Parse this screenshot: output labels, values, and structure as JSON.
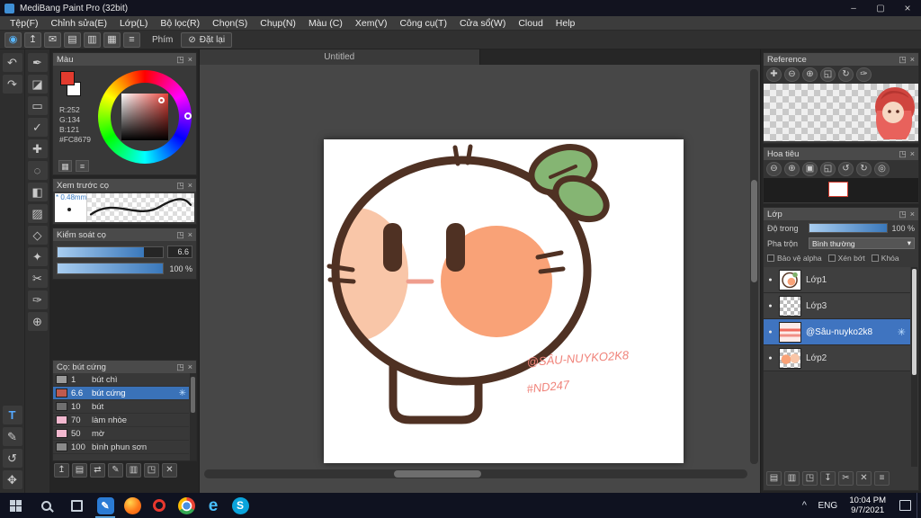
{
  "window": {
    "title": "MediBang Paint Pro (32bit)",
    "controls": {
      "minimize": "–",
      "maximize": "▢",
      "close": "×"
    }
  },
  "menu": {
    "items": [
      "Tệp(F)",
      "Chỉnh sửa(E)",
      "Lớp(L)",
      "Bộ lọc(R)",
      "Chọn(S)",
      "Chụp(N)",
      "Màu (C)",
      "Xem(V)",
      "Công cụ(T)",
      "Cửa sổ(W)",
      "Cloud",
      "Help"
    ]
  },
  "toolbar": {
    "icons": [
      {
        "name": "pen-cursor-icon",
        "glyph": "◉",
        "color": "#58b7ff"
      },
      {
        "name": "upload-icon",
        "glyph": "↥"
      },
      {
        "name": "comment-icon",
        "glyph": "✉"
      },
      {
        "name": "note-icon",
        "glyph": "▤"
      },
      {
        "name": "panel-icon",
        "glyph": "▥"
      },
      {
        "name": "grid-icon",
        "glyph": "▦"
      },
      {
        "name": "list-icon",
        "glyph": "≡"
      }
    ],
    "phim_label": "Phím",
    "reset_icon": "⊘",
    "reset_label": "Đặt lại"
  },
  "panel_icons": {
    "popout": "◳",
    "close": "×"
  },
  "tools": {
    "col1_top": [
      {
        "name": "undo-tool",
        "glyph": "↶"
      },
      {
        "name": "redo-tool",
        "glyph": "↷"
      }
    ],
    "col1_bottom": [
      {
        "name": "text-tool",
        "glyph": "T",
        "accent": true
      },
      {
        "name": "select-pen-tool",
        "glyph": "✎"
      },
      {
        "name": "rotate-canvas-tool",
        "glyph": "↺"
      },
      {
        "name": "hand-tool",
        "glyph": "✥"
      }
    ],
    "col2": [
      {
        "name": "brush-tool",
        "glyph": "✒"
      },
      {
        "name": "eraser-tool",
        "glyph": "◪"
      },
      {
        "name": "rect-tool",
        "glyph": "▭"
      },
      {
        "name": "check-tool",
        "glyph": "✓"
      },
      {
        "name": "move-tool",
        "glyph": "✚"
      },
      {
        "name": "marquee-select-tool",
        "glyph": "◌"
      },
      {
        "name": "bucket-tool",
        "glyph": "◧"
      },
      {
        "name": "gradient-tool",
        "glyph": "▨"
      },
      {
        "name": "polygon-select-tool",
        "glyph": "◇"
      },
      {
        "name": "wand-tool",
        "glyph": "✦"
      },
      {
        "name": "snip-tool",
        "glyph": "✂"
      },
      {
        "name": "eyedropper-tool",
        "glyph": "✑"
      },
      {
        "name": "zoom-tool",
        "glyph": "⊕"
      }
    ]
  },
  "color_panel": {
    "title": "Màu",
    "fg_color": "#e23b2e",
    "r_label": "R:252",
    "g_label": "G:134",
    "b_label": "B:121",
    "hex_label": "#FC8679",
    "footer_icons": [
      {
        "name": "palette-icon",
        "glyph": "▦"
      },
      {
        "name": "color-sliders-icon",
        "glyph": "≡"
      }
    ]
  },
  "brush_preview": {
    "title": "Xem trước cọ",
    "size_label": "* 0.48mm"
  },
  "brush_control": {
    "title": "Kiểm soát cọ",
    "rows": [
      {
        "value": "6.6",
        "fill": 82,
        "boxed": true
      },
      {
        "value": "100 %",
        "fill": 100
      }
    ]
  },
  "brush_list": {
    "title": "Cọ: bút cứng",
    "gear_glyph": "✳",
    "items": [
      {
        "size": "1",
        "name": "bút chì",
        "swatch": "#9a9a9a"
      },
      {
        "size": "6.6",
        "name": "bút cứng",
        "swatch": "#c05a4e",
        "selected": true
      },
      {
        "size": "10",
        "name": "bút",
        "swatch": "#6f6f6f"
      },
      {
        "size": "70",
        "name": "làm nhòe",
        "swatch": "#f2b8cf"
      },
      {
        "size": "50",
        "name": "mờ",
        "swatch": "#f2b8cf"
      },
      {
        "size": "100",
        "name": "bình phun sơn",
        "swatch": "#8a8a8a"
      }
    ],
    "bottom_icons": [
      {
        "name": "brush-menu-icon",
        "glyph": "↥"
      },
      {
        "name": "add-brush-icon",
        "glyph": "▤"
      },
      {
        "name": "brush-transfer-icon",
        "glyph": "⇄"
      },
      {
        "name": "edit-brush-icon",
        "glyph": "✎"
      },
      {
        "name": "brush-folder-icon",
        "glyph": "▥"
      },
      {
        "name": "duplicate-brush-icon",
        "glyph": "◳"
      },
      {
        "name": "delete-brush-icon",
        "glyph": "✕"
      }
    ]
  },
  "canvas": {
    "tab_title": "Untitled",
    "signature_line1": "@SÂU-NUYKO2K8",
    "signature_line2": "#ND247"
  },
  "reference_panel": {
    "title": "Reference",
    "toolbar_icons": [
      {
        "name": "ref-move-icon",
        "glyph": "✚"
      },
      {
        "name": "ref-zoom-out-icon",
        "glyph": "⊖"
      },
      {
        "name": "ref-zoom-in-icon",
        "glyph": "⊕"
      },
      {
        "name": "ref-fit-icon",
        "glyph": "◱"
      },
      {
        "name": "ref-rotate-icon",
        "glyph": "↻"
      },
      {
        "name": "ref-eyedropper-icon",
        "glyph": "✑"
      }
    ]
  },
  "navigator_panel": {
    "title": "Hoa tiêu",
    "toolbar_icons": [
      {
        "name": "nav-zoom-out-icon",
        "glyph": "⊖"
      },
      {
        "name": "nav-zoom-in-icon",
        "glyph": "⊕"
      },
      {
        "name": "nav-zoom-100-icon",
        "glyph": "▣"
      },
      {
        "name": "nav-fit-icon",
        "glyph": "◱"
      },
      {
        "name": "nav-rotate-left-icon",
        "glyph": "↺"
      },
      {
        "name": "nav-rotate-right-icon",
        "glyph": "↻"
      },
      {
        "name": "nav-reset-icon",
        "glyph": "◎"
      }
    ]
  },
  "layers_panel": {
    "title": "Lớp",
    "opacity_label": "Độ trong",
    "opacity_value": "100 %",
    "blend_label": "Pha trộn",
    "blend_value": "Bình thường",
    "blend_caret": "▾",
    "options": [
      "Bảo vệ alpha",
      "Xén bớt",
      "Khóa"
    ],
    "visibility_glyph": "●",
    "badge_glyph": "✳",
    "items": [
      {
        "name": "Lớp1",
        "thumb": "art"
      },
      {
        "name": "Lớp3",
        "thumb": "checker"
      },
      {
        "name": "@Sâu-nuyko2k8",
        "thumb": "sig",
        "selected": true
      },
      {
        "name": "Lớp2",
        "thumb": "checker-orange"
      }
    ],
    "bottom_icons": [
      {
        "name": "add-layer-icon",
        "glyph": "▤"
      },
      {
        "name": "duplicate-layer-icon",
        "glyph": "▥"
      },
      {
        "name": "layer-folder-icon",
        "glyph": "◳"
      },
      {
        "name": "merge-down-icon",
        "glyph": "↧"
      },
      {
        "name": "layer-transfer-icon",
        "glyph": "✂"
      },
      {
        "name": "delete-layer-icon",
        "glyph": "✕"
      },
      {
        "name": "layer-menu-icon",
        "glyph": "≡"
      }
    ]
  },
  "taskbar": {
    "apps": [
      {
        "name": "taskbar-app-medibang",
        "kind": "medibang",
        "glyph": "✎",
        "active": true
      },
      {
        "name": "taskbar-app-firefox",
        "kind": "firefox",
        "glyph": ""
      },
      {
        "name": "taskbar-app-opera",
        "kind": "opera",
        "glyph": ""
      },
      {
        "name": "taskbar-app-chrome",
        "kind": "chrome",
        "glyph": ""
      },
      {
        "name": "taskbar-app-edge",
        "kind": "edge",
        "glyph": "e"
      },
      {
        "name": "taskbar-app-skype",
        "kind": "skype",
        "glyph": "S"
      }
    ],
    "tray_chevron": "^",
    "lang": "ENG",
    "time": "10:04 PM",
    "date": "9/7/2021"
  }
}
